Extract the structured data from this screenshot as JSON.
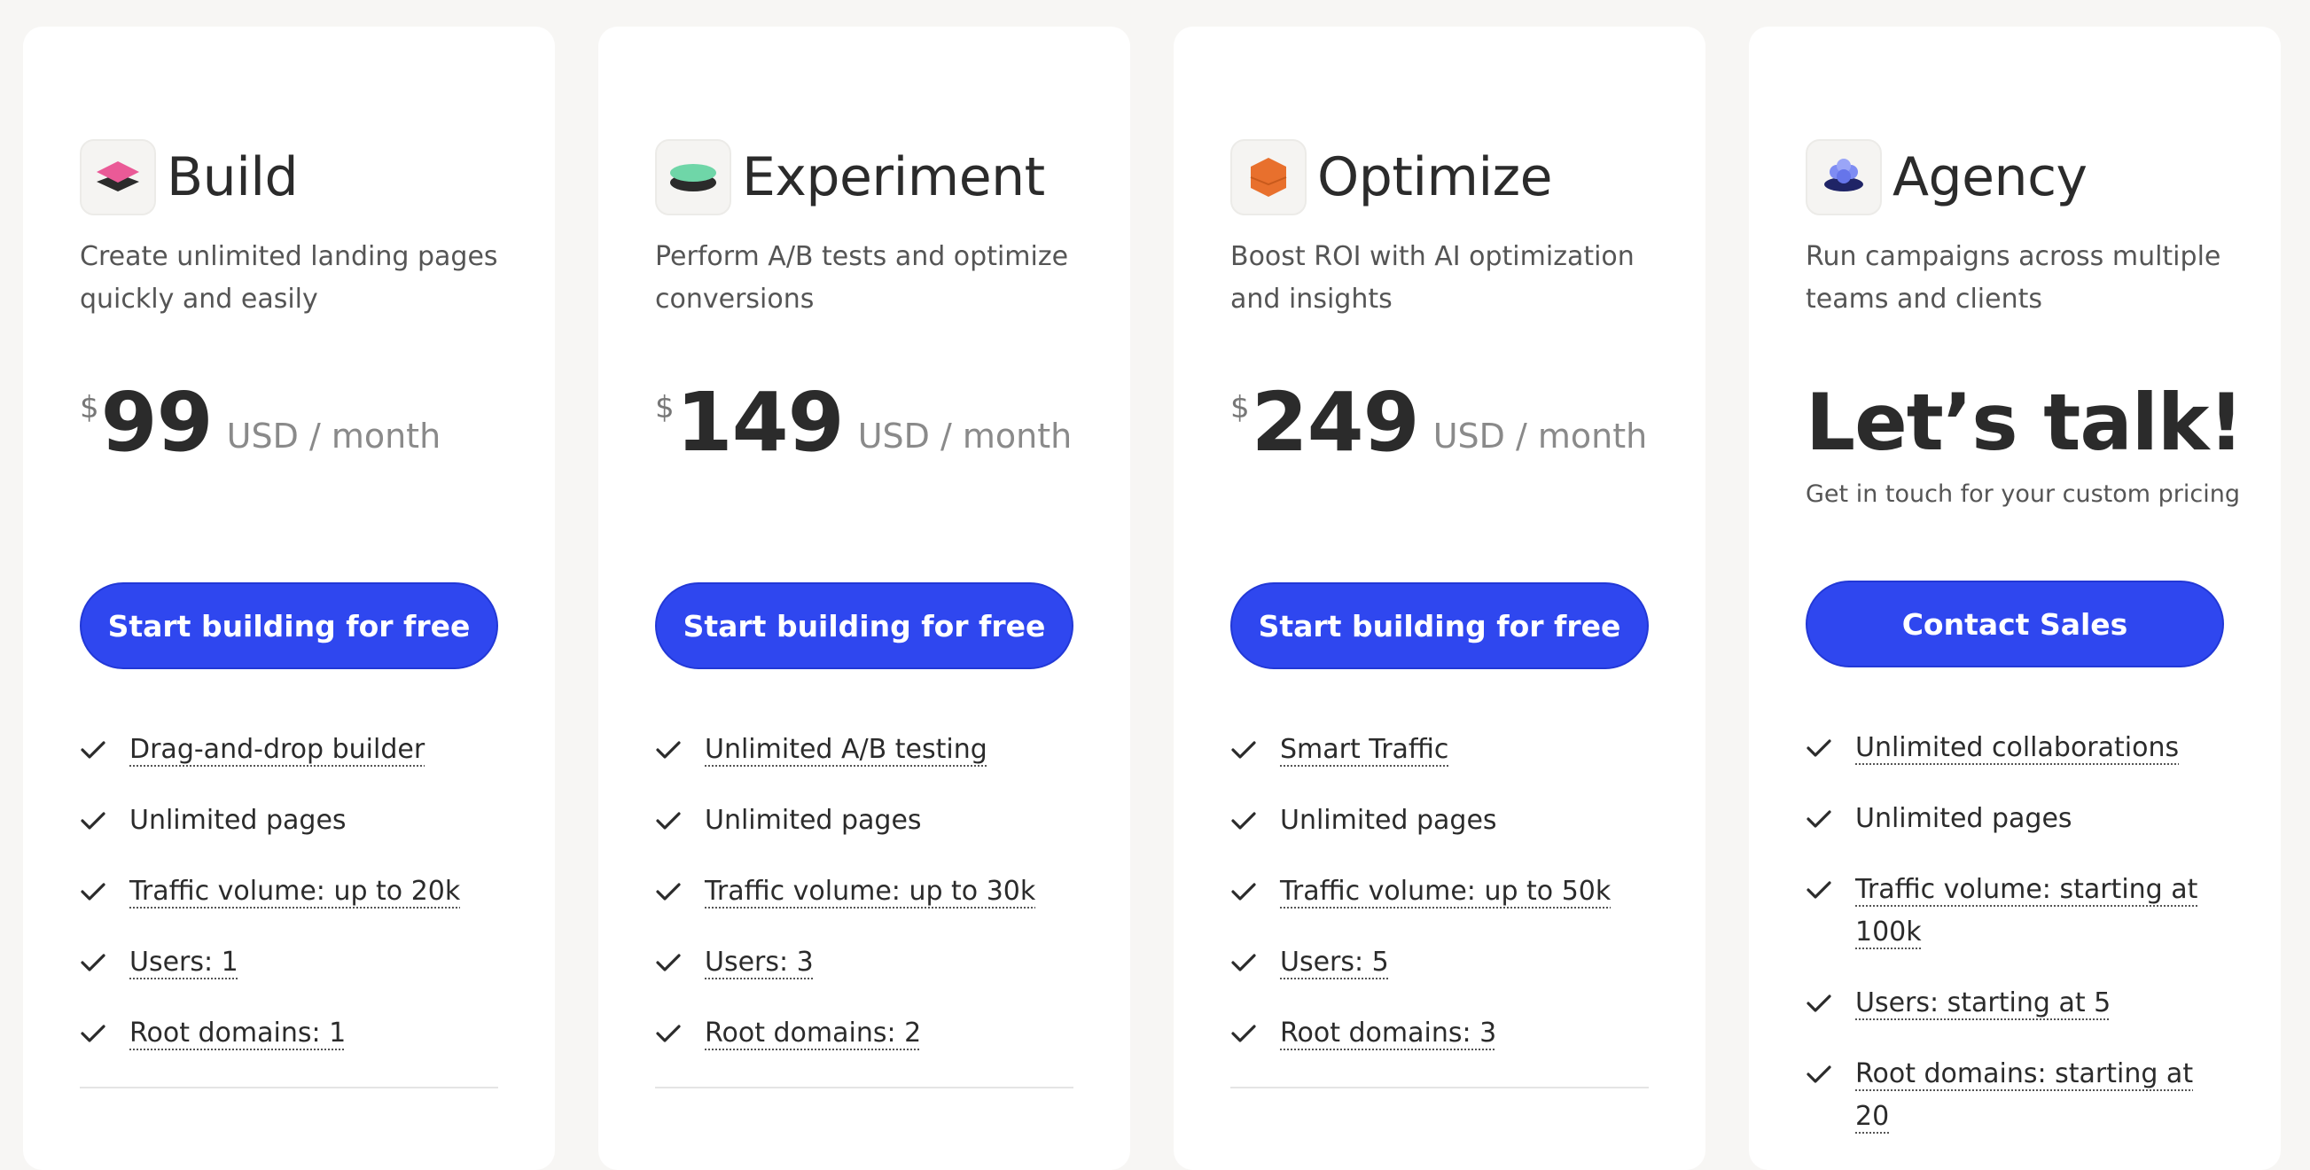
{
  "currency_symbol": "$",
  "plans": [
    {
      "name": "Build",
      "icon": "pink-layers-icon",
      "description": "Create unlimited landing pages quickly and easily",
      "price": "99",
      "period": "USD / month",
      "cta": "Start building for free",
      "features": [
        "Drag-and-drop builder",
        "Unlimited pages",
        "Traffic volume: up to 20k",
        "Users: 1",
        "Root domains: 1"
      ]
    },
    {
      "name": "Experiment",
      "icon": "green-layers-icon",
      "description": "Perform A/B tests and optimize conversions",
      "price": "149",
      "period": "USD / month",
      "cta": "Start building for free",
      "features": [
        "Unlimited A/B testing",
        "Unlimited pages",
        "Traffic volume: up to 30k",
        "Users: 3",
        "Root domains: 2"
      ]
    },
    {
      "name": "Optimize",
      "icon": "orange-hexagon-icon",
      "description": "Boost ROI with AI optimization and insights",
      "price": "249",
      "period": "USD / month",
      "cta": "Start building for free",
      "features": [
        "Smart Traffic",
        "Unlimited pages",
        "Traffic volume: up to 50k",
        "Users: 5",
        "Root domains: 3"
      ]
    },
    {
      "name": "Agency",
      "icon": "blue-flower-icon",
      "description": "Run campaigns across multiple teams and clients",
      "headline": "Let’s talk!",
      "subheadline": "Get in touch for your custom pricing",
      "cta": "Contact Sales",
      "features": [
        "Unlimited collaborations",
        "Unlimited pages",
        "Traffic volume: starting at 100k",
        "Users: starting at 5",
        "Root domains: starting at 20"
      ]
    }
  ],
  "colors": {
    "background": "#f7f6f4",
    "card": "#ffffff",
    "cta": "#2f47ef",
    "text": "#2b2b2b"
  }
}
